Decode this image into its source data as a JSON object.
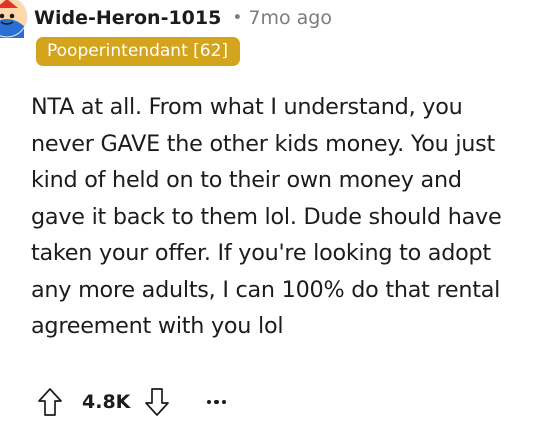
{
  "comment": {
    "author": "Wide-Heron-1015",
    "separator": "•",
    "age": "7mo ago",
    "flair": "Pooperintendant [62]",
    "body": "NTA at all. From what I understand, you\nnever GAVE the other kids money. You just\nkind of held on to their own money and\ngave it back to them lol. Dude should have\ntaken your offer. If you're looking to adopt\nany more adults, I can 100% do that rental\nagreement with you lol",
    "score": "4.8K"
  },
  "icons": {
    "avatar": "snoo-avatar-icon",
    "upvote": "upvote-arrow-icon",
    "downvote": "downvote-arrow-icon",
    "more": "more-options-icon"
  },
  "colors": {
    "flair_bg": "#d4a41c",
    "text": "#1c1c1c",
    "meta": "#7c7c7c"
  }
}
